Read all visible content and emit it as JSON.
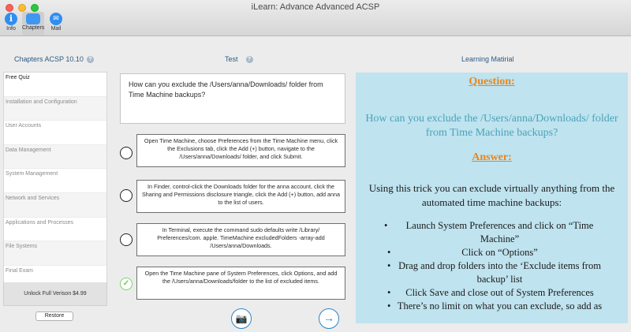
{
  "window": {
    "title": "iLearn: Advance Advanced ACSP"
  },
  "toolbar": {
    "items": [
      {
        "label": "Info",
        "icon": "info-icon",
        "glyph": "i"
      },
      {
        "label": "Chapters",
        "icon": "chapters-icon",
        "glyph": ""
      },
      {
        "label": "Mail",
        "icon": "mail-icon",
        "glyph": "✉"
      }
    ]
  },
  "headers": {
    "chapters": "Chapters ACSP 10.10",
    "test": "Test",
    "learning": "Learning Matirial",
    "help_glyph": "?"
  },
  "sidebar": {
    "items": [
      "Free Quiz",
      "Installation and Configuration",
      "User Accounts",
      "Data Management",
      "System Management",
      "Network and Services",
      "Applications and Processes",
      "File Systems",
      "Final Exam"
    ],
    "unlock": "Unlock Full Verison $4.99",
    "restore": "Restore"
  },
  "test": {
    "question": "How can you exclude the /Users/anna/Downloads/ folder from Time Machine backups?",
    "options": [
      "Open Time Machine, choose Preferences from the Time Machine menu, click the Exclusions tab, click the Add (+) button, navigate to the /Users/anna/Downloads/ folder, and click Submit.",
      "In Finder, control-click the Downloads folder for the anna account, click the Sharing and Permissions disclosure triangle, click the Add (+) button, add anna to the list of users.",
      "In Terminal, execute the command sudo defaults write /Library/ Preferences/com. apple. TimeMachine excludedFolders -array-add /Users/anna/Downloads.",
      "Open the Time Machine pane of System Preferences, click Options, and add the /Users/anna/Downloads/folder to the list of excluded items."
    ],
    "correct_mark": "✓",
    "camera_glyph": "📷",
    "next_glyph": "→"
  },
  "material": {
    "question_heading": "Question:",
    "question": "How can you exclude the /Users/anna/Downloads/ folder from Time Machine backups?",
    "answer_heading": "Answer:",
    "intro": "Using this trick you can exclude virtually anything from the automated time machine backups:",
    "bullets": [
      "Launch System Preferences and click on “Time Machine”",
      "Click on “Options”",
      "Drag and drop folders into the ‘Exclude items from backup’ list",
      "Click Save and close out of System Preferences",
      "There’s no limit on what you can exclude, so add as"
    ]
  }
}
